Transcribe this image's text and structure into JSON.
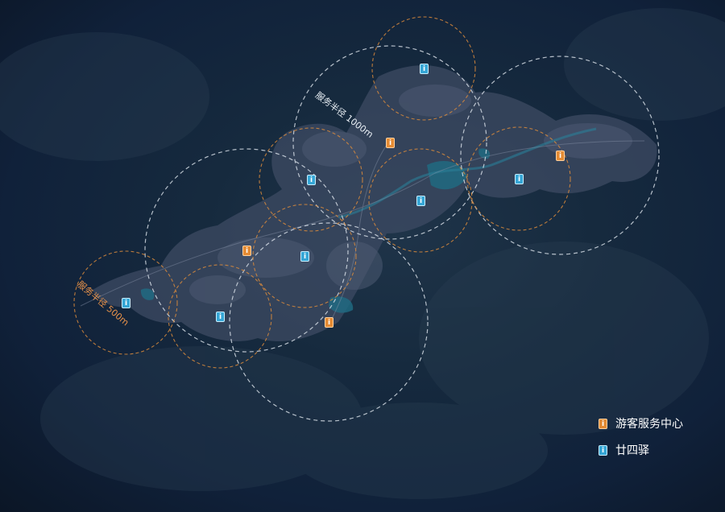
{
  "labels": {
    "radius_1000": "服务半径 1000m",
    "radius_500": "服务半径 500m"
  },
  "legend": {
    "visitor_center": "游客服务中心",
    "station": "廿四驿"
  },
  "icons": {
    "visitor_center": "info-icon",
    "station": "info-icon",
    "glyph": "i"
  },
  "colors": {
    "visitor_center": "#e58b33",
    "station": "#35a6d6",
    "radius_1000_ring": "#dfe6ee",
    "radius_500_ring": "#d98a3c",
    "background": "#13243a"
  }
}
